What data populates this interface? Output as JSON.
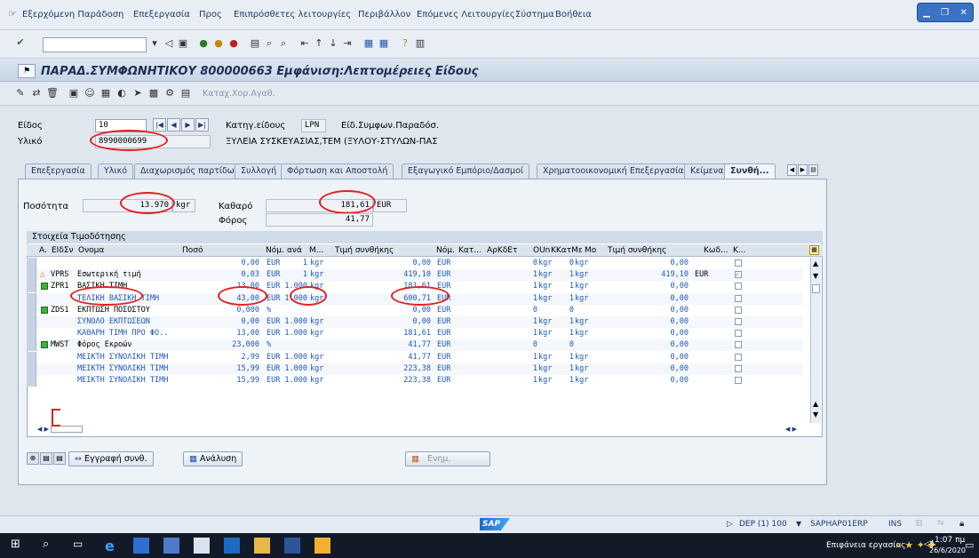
{
  "menu": [
    "Εξερχόμενη Παράδοση",
    "Επεξεργασία",
    "Προς",
    "Επιπρόσθετες λειτουργίες",
    "Περιβάλλον",
    "Επόμενες Λειτουργίες",
    "Σύστημα",
    "Βοήθεια"
  ],
  "title": "ΠΑΡΑΔ.ΣΥΜΦΩΝΗΤΙΚΟΥ 800000663 Εμφάνιση:Λεπτομέρειες Είδους",
  "app_toolbar_label": "Καταχ.Χορ.Αγαθ.",
  "header": {
    "item_label": "Είδος",
    "item_value": "10",
    "material_label": "Υλικό",
    "material_value": "8990000699",
    "itemcat_label": "Κατηγ.είδους",
    "itemcat_value": "LPN",
    "itemcat_desc": "Είδ.Συμφων.Παραδόσ.",
    "material_desc": "ΞΥΛΕΙΑ ΣΥΣΚΕΥΑΣΙΑΣ,ΤΕΜ (ΞΥΛΟΥ-ΣΤΥΛΩΝ-ΠΑΣ"
  },
  "tabs": [
    "Επεξεργασία",
    "Υλικό",
    "Διαχωρισμός παρτίδων",
    "Συλλογή",
    "Φόρτωση και Αποστολή",
    "Εξαγωγικό Εμπόριο/Δασμοί",
    "Χρηματοοικονομική Επεξεργασία",
    "Κείμενα",
    "Συνθή..."
  ],
  "summary": {
    "qty_label": "Ποσότητα",
    "qty_value": "13.970",
    "qty_unit": "kgr",
    "net_label": "Καθαρό",
    "net_value": "181,61",
    "net_currency": "EUR",
    "tax_label": "Φόρος",
    "tax_value": "41,77"
  },
  "grid": {
    "title": "Στοιχεία Τιμοδότησης",
    "headers": [
      "Α.",
      "ΕΙδΣν",
      "Ονομα",
      "Ποσό",
      "Νόμ.",
      "ανά",
      "Μ...",
      "Τιμή συνθήκης",
      "Νόμ.",
      "Κατ...",
      "ΑρΚδΕτ",
      "OUn",
      "ΚΚατΜε",
      "Mo",
      "Τιμή συνθήκης",
      "Κωδ...",
      "Κ..."
    ],
    "rows": [
      {
        "status": "",
        "type": "",
        "name": "",
        "amount": "0,00",
        "cur": "EUR",
        "per": "1",
        "uom": "kgr",
        "cval": "0,00",
        "ccur": "EUR",
        "oun": "0",
        "oun_u": "kgr",
        "kk": "0",
        "kk_u": "kgr",
        "cval2": "0,00",
        "code": "",
        "blue": true
      },
      {
        "status": "warn",
        "type": "VPRS",
        "name": "Εσωτερική τιμή",
        "amount": "0,03",
        "cur": "EUR",
        "per": "1",
        "uom": "kgr",
        "cval": "419,10",
        "ccur": "EUR",
        "oun": "1",
        "oun_u": "kgr",
        "kk": "1",
        "kk_u": "kgr",
        "cval2": "419,10",
        "code": "EUR",
        "blue": false,
        "checked": true
      },
      {
        "status": "ok",
        "type": "ZPR1",
        "name": "ΒΑΣΙΚΗ ΤΙΜΗ",
        "amount": "13,00",
        "cur": "EUR",
        "per": "1.000",
        "uom": "kgr",
        "cval": "181,61",
        "ccur": "EUR",
        "oun": "1",
        "oun_u": "kgr",
        "kk": "1",
        "kk_u": "kgr",
        "cval2": "0,00",
        "code": "",
        "blue": false
      },
      {
        "status": "",
        "type": "",
        "name": "ΤΕΛΙΚΗ ΒΑΣΙΚΗ ΤΙΜΗ",
        "amount": "43,00",
        "cur": "EUR",
        "per": "1.000",
        "uom": "kgr",
        "cval": "600,71",
        "ccur": "EUR",
        "oun": "1",
        "oun_u": "kgr",
        "kk": "1",
        "kk_u": "kgr",
        "cval2": "0,00",
        "code": "",
        "blue": true
      },
      {
        "status": "ok",
        "type": "ZDS1",
        "name": "ΕΚΠΤΩΣΗ ΠΟΣΟΣΤΟΥ",
        "amount": "0,000",
        "cur": "%",
        "per": "",
        "uom": "",
        "cval": "0,00",
        "ccur": "EUR",
        "oun": "0",
        "oun_u": "",
        "kk": "0",
        "kk_u": "",
        "cval2": "0,00",
        "code": "",
        "blue": false
      },
      {
        "status": "",
        "type": "",
        "name": "ΣΥΝΟΛΟ ΕΚΠΤΩΣΕΩΝ",
        "amount": "0,00",
        "cur": "EUR",
        "per": "1.000",
        "uom": "kgr",
        "cval": "0,00",
        "ccur": "EUR",
        "oun": "1",
        "oun_u": "kgr",
        "kk": "1",
        "kk_u": "kgr",
        "cval2": "0,00",
        "code": "",
        "blue": true
      },
      {
        "status": "",
        "type": "",
        "name": "ΚΑΘΑΡΗ ΤΙΜΗ ΠΡΟ ΦΟ..",
        "amount": "13,00",
        "cur": "EUR",
        "per": "1.000",
        "uom": "kgr",
        "cval": "181,61",
        "ccur": "EUR",
        "oun": "1",
        "oun_u": "kgr",
        "kk": "1",
        "kk_u": "kgr",
        "cval2": "0,00",
        "code": "",
        "blue": true
      },
      {
        "status": "ok",
        "type": "MWST",
        "name": "Φόρος Εκροών",
        "amount": "23,000",
        "cur": "%",
        "per": "",
        "uom": "",
        "cval": "41,77",
        "ccur": "EUR",
        "oun": "0",
        "oun_u": "",
        "kk": "0",
        "kk_u": "",
        "cval2": "0,00",
        "code": "",
        "blue": false
      },
      {
        "status": "",
        "type": "",
        "name": "ΜΕΙΚΤΗ ΣΥΝΟΛΙΚΗ ΤΙΜΗ",
        "amount": "2,99",
        "cur": "EUR",
        "per": "1.000",
        "uom": "kgr",
        "cval": "41,77",
        "ccur": "EUR",
        "oun": "1",
        "oun_u": "kgr",
        "kk": "1",
        "kk_u": "kgr",
        "cval2": "0,00",
        "code": "",
        "blue": true
      },
      {
        "status": "",
        "type": "",
        "name": "ΜΕΙΚΤΗ ΣΥΝΟΛΙΚΗ ΤΙΜΗ",
        "amount": "15,99",
        "cur": "EUR",
        "per": "1.000",
        "uom": "kgr",
        "cval": "223,38",
        "ccur": "EUR",
        "oun": "1",
        "oun_u": "kgr",
        "kk": "1",
        "kk_u": "kgr",
        "cval2": "0,00",
        "code": "",
        "blue": true
      },
      {
        "status": "",
        "type": "",
        "name": "ΜΕΙΚΤΗ ΣΥΝΟΛΙΚΗ ΤΙΜΗ",
        "amount": "15,99",
        "cur": "EUR",
        "per": "1.000",
        "uom": "kgr",
        "cval": "223,38",
        "ccur": "EUR",
        "oun": "1",
        "oun_u": "kgr",
        "kk": "1",
        "kk_u": "kgr",
        "cval2": "0,00",
        "code": "",
        "blue": true
      }
    ]
  },
  "buttons": {
    "post_cond": "Εγγραφή συνθ.",
    "analysis": "Ανάλυση",
    "update": "Ενημ."
  },
  "status": {
    "system": "DEP (1) 100",
    "server": "SAPHAP01ERP",
    "mode": "INS"
  },
  "taskbar": {
    "notify": "Επιφάνεια εργασίας",
    "lang": "ΕΛ",
    "time": "1:07 πμ",
    "date": "26/6/2020"
  },
  "colors": {
    "accent": "#1d58b8",
    "highlight": "#e02020"
  }
}
